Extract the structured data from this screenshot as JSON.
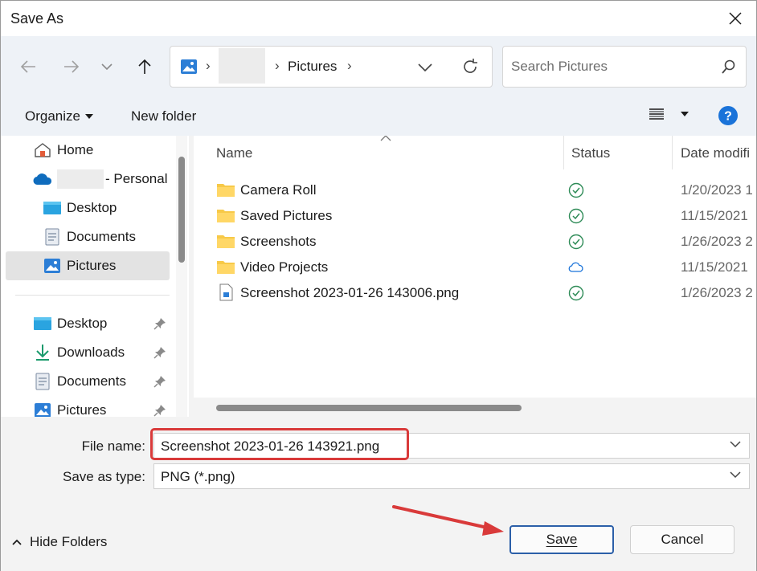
{
  "window": {
    "title": "Save As"
  },
  "nav": {
    "path": [
      {
        "label": "",
        "hidden": true
      },
      {
        "label": "Pictures"
      }
    ]
  },
  "search": {
    "placeholder": "Search Pictures",
    "value": ""
  },
  "commandbar": {
    "organize_label": "Organize",
    "new_folder_label": "New folder"
  },
  "sidebar": {
    "items": [
      {
        "label": "Home",
        "icon": "home-icon"
      },
      {
        "label": "- Personal",
        "icon": "onedrive-cloud-icon"
      },
      {
        "label": "Desktop",
        "icon": "desktop-icon"
      },
      {
        "label": "Documents",
        "icon": "documents-icon"
      },
      {
        "label": "Pictures",
        "icon": "pictures-icon",
        "selected": true
      }
    ],
    "quick_access": [
      {
        "label": "Desktop",
        "icon": "desktop-icon",
        "pinned": true
      },
      {
        "label": "Downloads",
        "icon": "downloads-icon",
        "pinned": true
      },
      {
        "label": "Documents",
        "icon": "documents-icon",
        "pinned": true
      },
      {
        "label": "Pictures",
        "icon": "pictures-icon",
        "pinned": true
      }
    ]
  },
  "filelist": {
    "columns": [
      "Name",
      "Status",
      "Date modifi"
    ],
    "rows": [
      {
        "name": "Camera Roll",
        "type": "folder",
        "status": "synced",
        "date": "1/20/2023 1"
      },
      {
        "name": "Saved Pictures",
        "type": "folder",
        "status": "synced",
        "date": "11/15/2021"
      },
      {
        "name": "Screenshots",
        "type": "folder",
        "status": "synced",
        "date": "1/26/2023 2"
      },
      {
        "name": "Video Projects",
        "type": "folder",
        "status": "cloud",
        "date": "11/15/2021"
      },
      {
        "name": "Screenshot 2023-01-26 143006.png",
        "type": "image",
        "status": "synced",
        "date": "1/26/2023 2"
      }
    ]
  },
  "form": {
    "filename_label": "File name:",
    "filename_value": "Screenshot 2023-01-26 143921.png",
    "savetype_label": "Save as type:",
    "savetype_value": "PNG (*.png)",
    "hide_folders_label": "Hide Folders",
    "save_label": "Save",
    "cancel_label": "Cancel"
  },
  "colors": {
    "accent": "#0067c0",
    "highlight_box": "#d93a3a",
    "sync_ok": "#2e8b57",
    "folder": "#f7c948"
  }
}
